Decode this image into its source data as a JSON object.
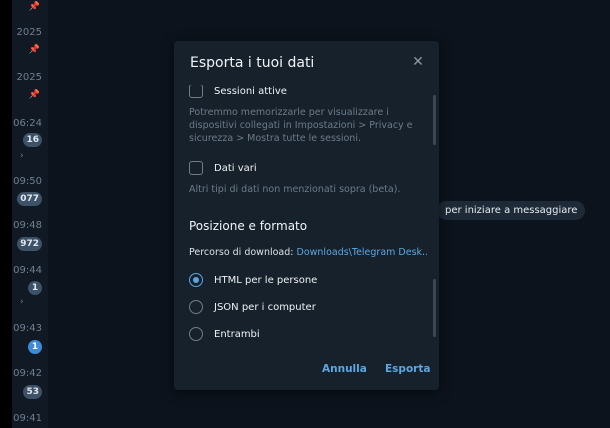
{
  "chat_list": {
    "items": [
      {
        "time": "2025"
      },
      {
        "time": "2025"
      },
      {
        "time": "06:24",
        "badge": "16"
      },
      {
        "time": "09:50",
        "badge": "077"
      },
      {
        "time": "09:48",
        "badge": "972"
      },
      {
        "time": "09:44",
        "badge": "1"
      },
      {
        "time": "09:43",
        "badge": "1"
      },
      {
        "time": "09:42",
        "badge": "53"
      },
      {
        "time": "09:41"
      }
    ]
  },
  "chat_hint": "per iniziare a messaggiare",
  "dialog": {
    "title": "Esporta i tuoi dati",
    "sessions": {
      "label": "Sessioni attive",
      "checked": false,
      "description": "Potremmo memorizzarle per visualizzare i dispositivi collegati in Impostazioni > Privacy e sicurezza > Mostra tutte le sessioni."
    },
    "misc": {
      "label": "Dati vari",
      "checked": false,
      "description": "Altri tipi di dati non menzionati sopra (beta)."
    },
    "location_section": {
      "title": "Posizione e formato",
      "path_label": "Percorso di download:",
      "path_value": "Downloads\\Telegram Desk..."
    },
    "format_options": [
      {
        "label": "HTML per le persone",
        "selected": true
      },
      {
        "label": "JSON per i computer",
        "selected": false
      },
      {
        "label": "Entrambi",
        "selected": false
      }
    ],
    "buttons": {
      "cancel": "Annulla",
      "export": "Esporta"
    }
  },
  "colors": {
    "accent": "#5aa7e3",
    "dialog_bg": "#17212b",
    "window_bg": "#0e1621",
    "badge_unread": "#3f8ad7"
  }
}
